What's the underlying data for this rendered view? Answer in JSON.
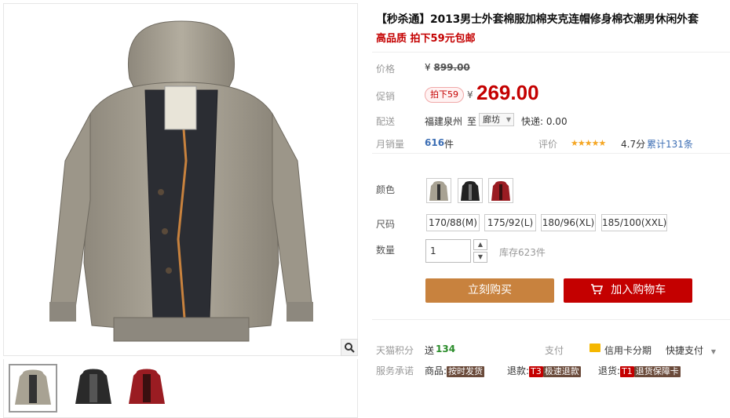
{
  "product": {
    "title": "【秒杀通】2013男士外套棉服加棉夹克连帽修身棉衣潮男休闲外套",
    "subtitle": "高品质 拍下59元包邮"
  },
  "price": {
    "label": "价格",
    "currency": "¥",
    "original": "899.00",
    "promo_label": "促销",
    "promo_tag": "拍下59",
    "promo_price": "269.00"
  },
  "delivery": {
    "label": "配送",
    "from": "福建泉州",
    "to_word": "至",
    "to_city": "廊坊",
    "shipping": "快递: 0.00"
  },
  "sales": {
    "label": "月销量",
    "count": "616",
    "unit": "件",
    "rating_label": "评价",
    "stars": "★★★★★",
    "score": "4.7分",
    "reviews": "累计131条"
  },
  "sku": {
    "color_label": "颜色",
    "colors": [
      "卡其",
      "黑色",
      "红色"
    ],
    "size_label": "尺码",
    "sizes": [
      "170/88(M)",
      "175/92(L)",
      "180/96(XL)",
      "185/100(XXL)"
    ],
    "qty_label": "数量",
    "qty_value": "1",
    "stock": "库存623件"
  },
  "actions": {
    "buy_now": "立刻购买",
    "add_cart": "加入购物车"
  },
  "extras": {
    "points_label": "天猫积分",
    "points_prefix": "送",
    "points_value": "134",
    "pay_label": "支付",
    "credit_label": "信用卡分期",
    "quick_pay": "快捷支付",
    "promise_label": "服务承诺",
    "goods_label": "商品:",
    "goods_badge": "按时发货",
    "refund_label": "退款:",
    "refund_code": "T3",
    "refund_badge": "极速退款",
    "return_label": "退货:",
    "return_code": "T1",
    "return_badge": "退货保障卡"
  },
  "colors": {
    "accent": "#c40000",
    "buy_button": "#c8823e",
    "star": "#f5a623"
  }
}
